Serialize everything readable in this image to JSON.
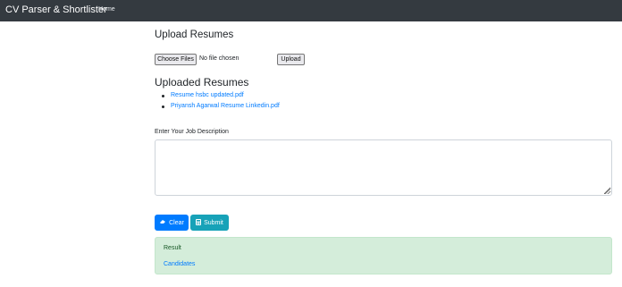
{
  "navbar": {
    "brand": "CV Parser & Shortlister",
    "home_label": "Home",
    "bg_color": "#343a40"
  },
  "upload": {
    "heading": "Upload Resumes",
    "choose_label": "Choose Files",
    "no_file_text": "No file chosen",
    "upload_label": "Upload"
  },
  "uploaded": {
    "heading": "Uploaded Resumes",
    "files": [
      "Resume hsbc updated.pdf",
      "Priyansh Agarwal Resume Linkedin.pdf"
    ]
  },
  "job_description": {
    "label": "Enter Your Job Description",
    "value": ""
  },
  "actions": {
    "clear_label": "Clear",
    "clear_icon": "eraser-icon",
    "clear_color": "#007bff",
    "submit_label": "Submit",
    "submit_icon": "calculator-icon",
    "submit_color": "#17a2b8"
  },
  "result": {
    "label": "Result",
    "candidates_link": "Candidates",
    "bg_color": "#d4edda"
  }
}
